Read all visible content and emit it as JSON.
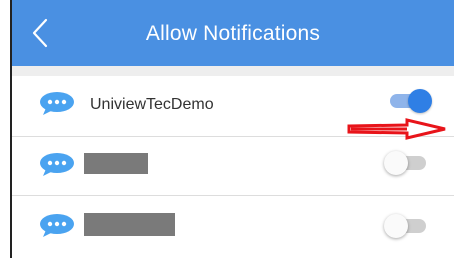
{
  "header": {
    "title": "Allow Notifications",
    "back_icon": "chevron-left-icon",
    "background_color": "#4a90e2"
  },
  "apps": [
    {
      "name": "UniviewTecDemo",
      "icon": "chat-bubble-icon",
      "enabled": true,
      "redacted": false
    },
    {
      "name": "",
      "icon": "chat-bubble-icon",
      "enabled": false,
      "redacted": true
    },
    {
      "name": "",
      "icon": "chat-bubble-icon",
      "enabled": false,
      "redacted": true
    }
  ],
  "colors": {
    "toggle_on": "#2f7fe5",
    "toggle_off": "#cfcfcf",
    "annotation_arrow": "#e8141a",
    "icon_bubble": "#4aa3f0"
  },
  "annotation": {
    "type": "arrow",
    "color": "#e8141a"
  }
}
